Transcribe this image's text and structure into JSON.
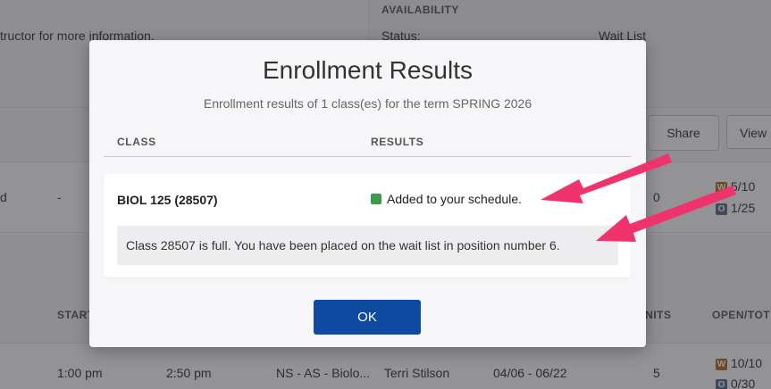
{
  "background": {
    "instruction_fragment": "tructor for more information.",
    "availability": {
      "heading": "AVAILABILITY",
      "status_label": "Status:",
      "status_value": "Wait List"
    },
    "toolbar": {
      "share_label": "Share",
      "view_label": "View"
    },
    "row1": {
      "col_a": "d",
      "col_b": "-",
      "units": "0",
      "wait_badge": "W",
      "wait_count": "5/10",
      "open_badge": "O",
      "open_count": "1/25"
    },
    "table_headers": {
      "start": "START",
      "units": "UNITS",
      "open_total": "OPEN/TOT"
    },
    "row2": {
      "start": "1:00 pm",
      "end": "2:50 pm",
      "location": "NS - AS - Biolo...",
      "instructor": "Terri Stilson",
      "dates": "04/06 - 06/22",
      "units": "5",
      "wait_badge": "W",
      "wait_count": "10/10",
      "open_badge": "O",
      "open_count": "0/30"
    }
  },
  "modal": {
    "title": "Enrollment Results",
    "subtitle": "Enrollment results of 1 class(es) for the term SPRING 2026",
    "headers": {
      "class": "CLASS",
      "results": "RESULTS"
    },
    "result": {
      "class_name": "BIOL 125 (28507)",
      "status": "Added to your schedule.",
      "status_color": "#3c9a48",
      "message": "Class 28507 is full. You have been placed on the wait list in position number 6."
    },
    "ok_label": "OK"
  },
  "colors": {
    "primary_button": "#0f4aa2",
    "annotation_arrow": "#f0336b",
    "wait_badge": "#b36b16",
    "open_badge": "#5a6a8a"
  }
}
